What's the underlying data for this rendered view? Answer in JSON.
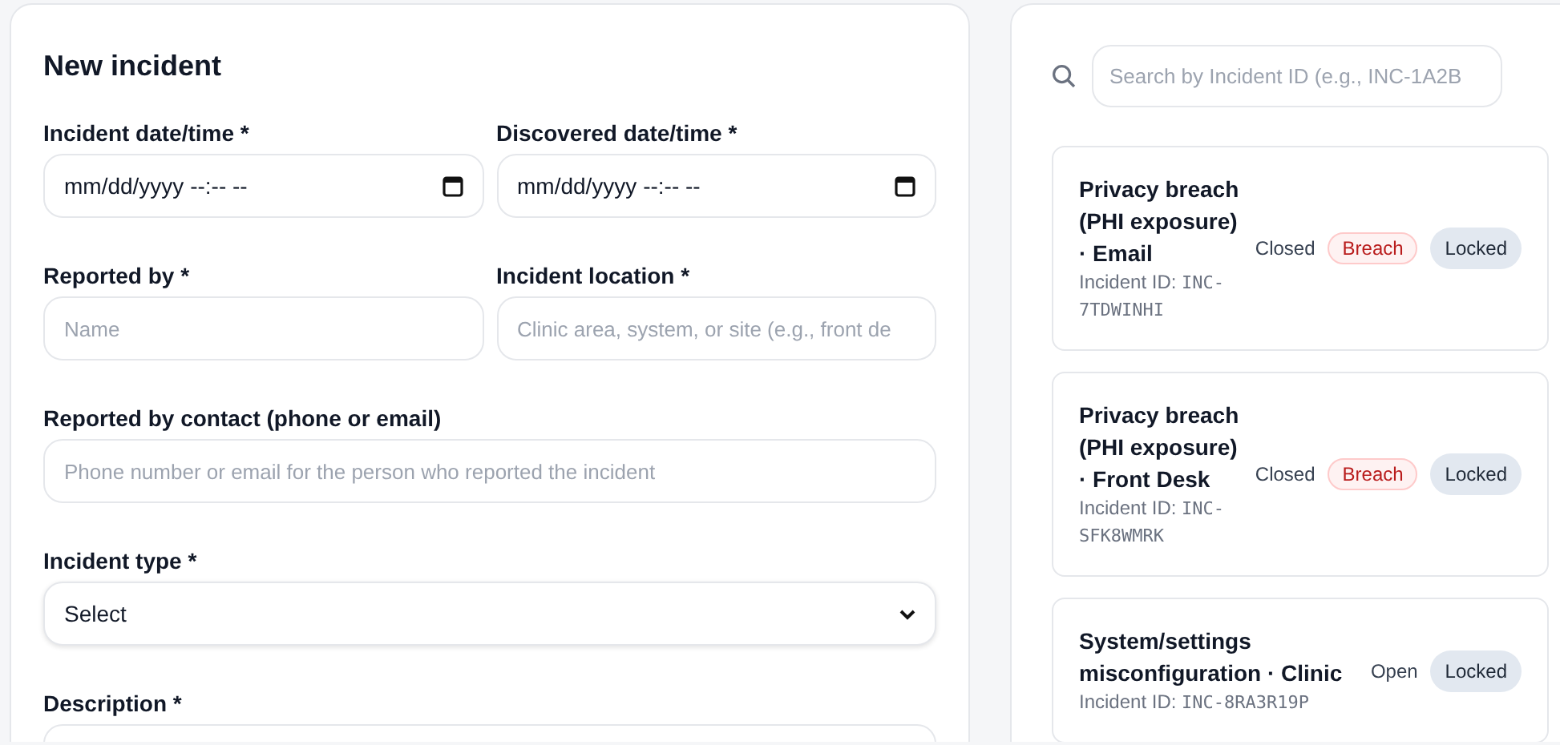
{
  "form": {
    "title": "New incident",
    "rows": [
      {
        "fields": [
          {
            "kind": "datetime",
            "label": "Incident date/time *",
            "value": "mm/dd/yyyy --:-- --"
          },
          {
            "kind": "datetime",
            "label": "Discovered date/time *",
            "value": "mm/dd/yyyy --:-- --"
          }
        ]
      },
      {
        "fields": [
          {
            "kind": "text",
            "label": "Reported by *",
            "placeholder": "Name"
          },
          {
            "kind": "text",
            "label": "Incident location *",
            "placeholder": "Clinic area, system, or site (e.g., front de"
          }
        ]
      },
      {
        "fields": [
          {
            "kind": "text",
            "label": "Reported by contact (phone or email)",
            "placeholder": "Phone number or email for the person who reported the incident"
          }
        ]
      },
      {
        "fields": [
          {
            "kind": "select",
            "label": "Incident type *",
            "value": "Select"
          }
        ]
      },
      {
        "fields": [
          {
            "kind": "textarea",
            "label": "Description *"
          }
        ]
      }
    ]
  },
  "search": {
    "placeholder": "Search by Incident ID (e.g., INC-1A2B"
  },
  "incidents": [
    {
      "title": "Privacy breach (PHI exposure) · Email",
      "id_label": "Incident ID:",
      "id": "INC-7TDWINHI",
      "status": "Closed",
      "tags": [
        {
          "kind": "breach",
          "label": "Breach"
        },
        {
          "kind": "locked",
          "label": "Locked"
        }
      ]
    },
    {
      "title": "Privacy breach (PHI exposure) · Front Desk",
      "id_label": "Incident ID:",
      "id": "INC-SFK8WMRK",
      "status": "Closed",
      "tags": [
        {
          "kind": "breach",
          "label": "Breach"
        },
        {
          "kind": "locked",
          "label": "Locked"
        }
      ]
    },
    {
      "title": "System/settings misconfiguration · Clinic",
      "id_label": "Incident ID:",
      "id": "INC-8RA3R19P",
      "status": "Open",
      "tags": [
        {
          "kind": "locked",
          "label": "Locked"
        }
      ]
    }
  ]
}
